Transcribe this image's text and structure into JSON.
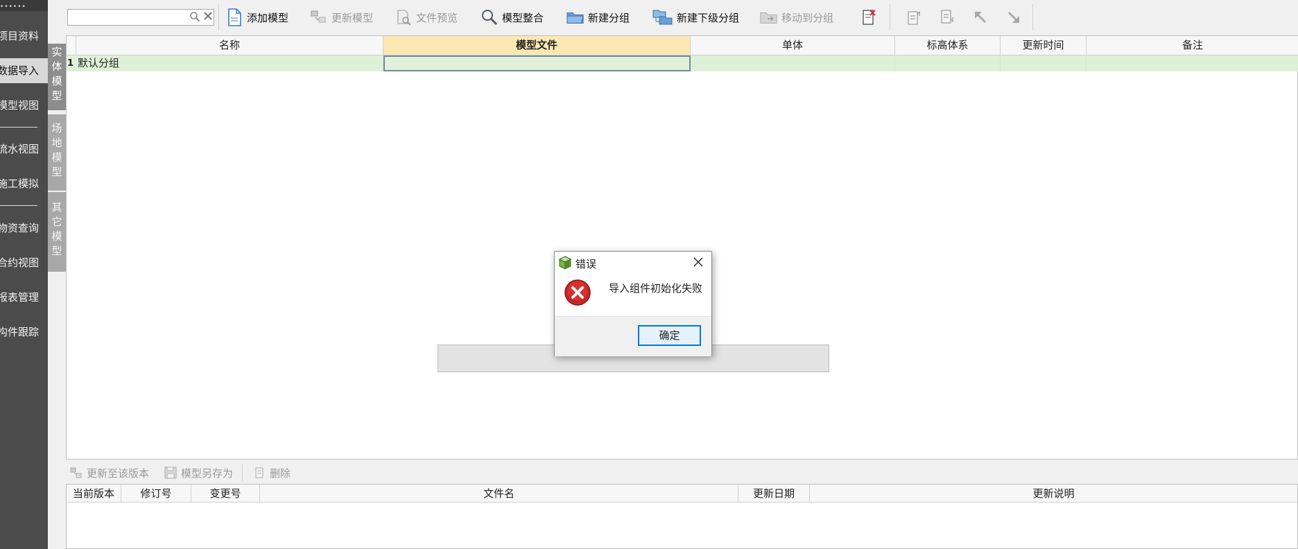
{
  "left_nav": {
    "items": [
      {
        "label": "项目资料"
      },
      {
        "label": "数据导入",
        "active": true
      },
      {
        "label": "模型视图"
      },
      {
        "label": "流水视图"
      },
      {
        "label": "施工模拟"
      },
      {
        "label": "物资查询"
      },
      {
        "label": "合约视图"
      },
      {
        "label": "报表管理"
      },
      {
        "label": "构件跟踪"
      }
    ]
  },
  "model_tabs": [
    {
      "label": "实体模型",
      "active": true
    },
    {
      "label": "场地模型"
    },
    {
      "label": "其它模型"
    }
  ],
  "toolbar": {
    "search_value": "",
    "buttons": {
      "add_model": "添加模型",
      "update_model": "更新模型",
      "file_preview": "文件预览",
      "model_merge": "模型整合",
      "new_group": "新建分组",
      "new_subgroup": "新建下级分组",
      "move_to_group": "移动到分组"
    }
  },
  "grid": {
    "columns": [
      "名称",
      "模型文件",
      "单体",
      "标高体系",
      "更新时间",
      "备注"
    ],
    "selected_column": "模型文件",
    "rows": [
      {
        "index": "1",
        "name": "默认分组",
        "file": "",
        "unit": "",
        "elevation": "",
        "updated": "",
        "note": ""
      }
    ]
  },
  "bottom_toolbar": {
    "update_to_version": "更新至该版本",
    "save_model_as": "模型另存为",
    "delete": "删除"
  },
  "bottom_grid": {
    "columns": [
      "当前版本",
      "修订号",
      "变更号",
      "文件名",
      "更新日期",
      "更新说明"
    ]
  },
  "dialog": {
    "title": "错误",
    "message": "导入组件初始化失败",
    "ok_label": "确定"
  },
  "colors": {
    "nav_bg": "#4b4b4b",
    "row_green": "#dff0d8",
    "selected_header": "#fce8b2",
    "error_red": "#c62828",
    "ok_border": "#0078d7"
  }
}
